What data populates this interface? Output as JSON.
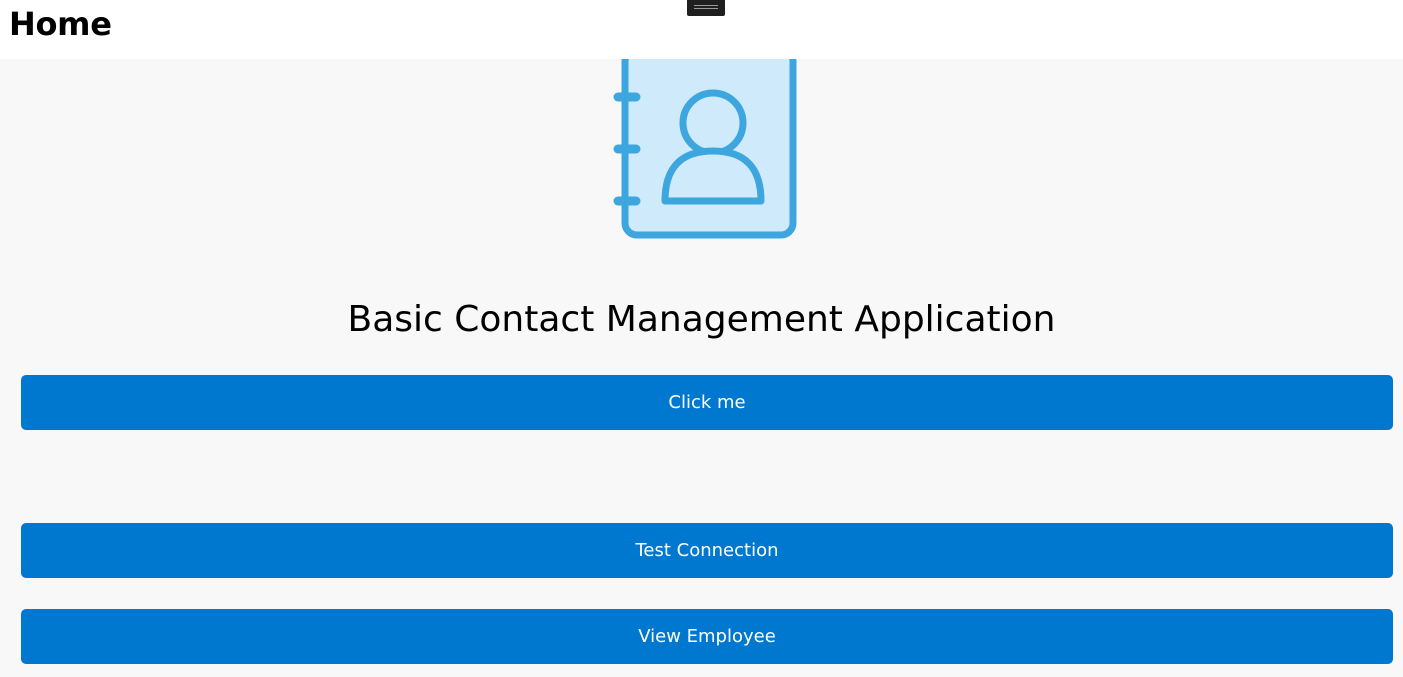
{
  "header": {
    "title": "Home"
  },
  "logo": {
    "icon": "contact-book-icon",
    "colors": {
      "stroke": "#3ea6de",
      "fill": "#cfeafb"
    }
  },
  "main": {
    "heading": "Basic Contact Management Application",
    "buttons": [
      {
        "label": "Click me"
      },
      {
        "label": "Test Connection"
      },
      {
        "label": "View Employee"
      }
    ]
  },
  "theme": {
    "accent": "#0078cf",
    "background": "#f8f8f8",
    "header_background": "#ffffff"
  }
}
